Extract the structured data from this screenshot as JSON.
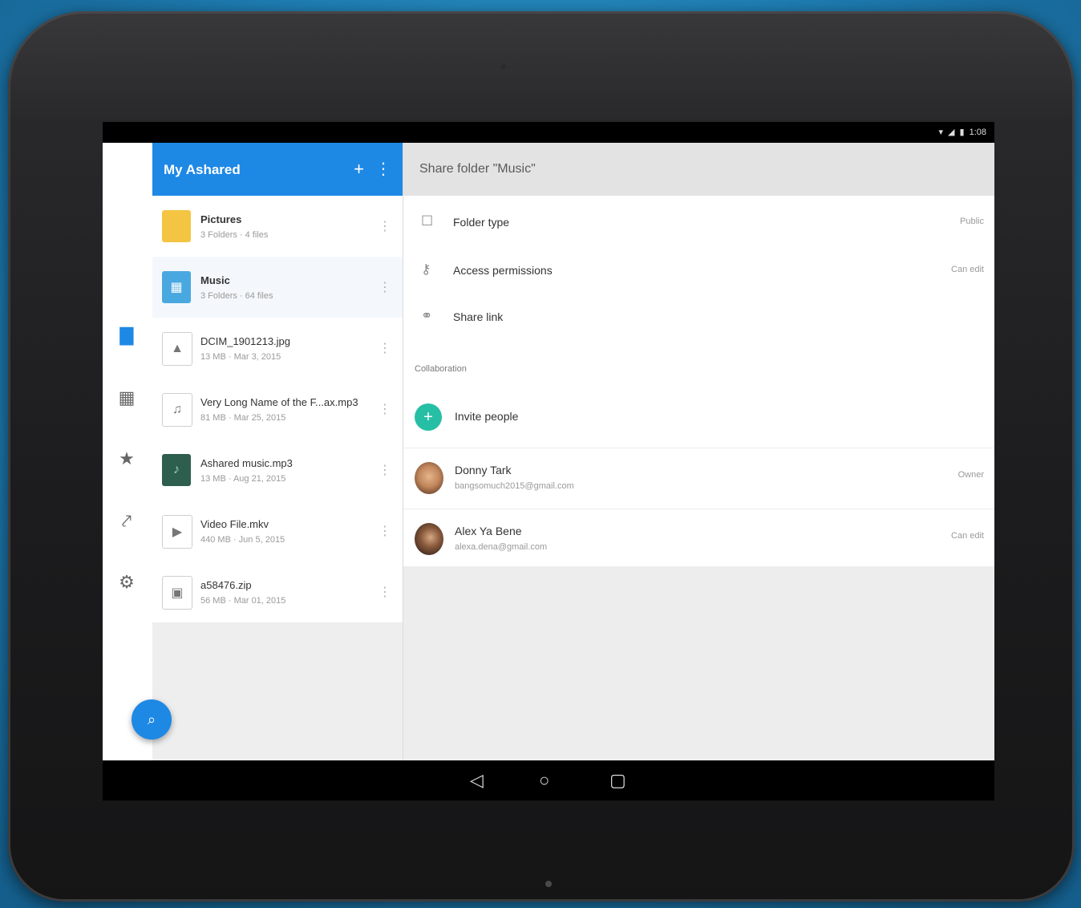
{
  "status_bar": {
    "icons": [
      "wifi-icon",
      "signal-icon",
      "battery-icon"
    ],
    "time": "1:08"
  },
  "rail": {
    "items": [
      {
        "icon": "folder-icon",
        "glyph": "▇",
        "active": true
      },
      {
        "icon": "shared-folder-icon",
        "glyph": "▦",
        "active": false
      },
      {
        "icon": "star-icon",
        "glyph": "★",
        "active": false
      },
      {
        "icon": "activity-icon",
        "glyph": "⤤",
        "active": false
      },
      {
        "icon": "settings-icon",
        "glyph": "⚙",
        "active": false
      }
    ],
    "fab_icon": "search-icon"
  },
  "list": {
    "title": "My Ashared",
    "add_icon": "plus-icon",
    "menu_icon": "more-vertical-icon",
    "files": [
      {
        "name": "Pictures",
        "meta": "3 Folders · 4 files",
        "icon": "folder-icon",
        "style": "folder-y",
        "bold": true,
        "selected": false,
        "glyph": ""
      },
      {
        "name": "Music",
        "meta": "3 Folders · 64 files",
        "icon": "shared-folder-icon",
        "style": "folder-b",
        "bold": true,
        "selected": true,
        "glyph": "▦"
      },
      {
        "name": "DCIM_1901213.jpg",
        "meta": "13 MB · Mar 3, 2015",
        "icon": "image-file-icon",
        "style": "doc",
        "bold": false,
        "selected": false,
        "glyph": "▲"
      },
      {
        "name": "Very Long Name of the F...ax.mp3",
        "meta": "81 MB · Mar 25, 2015",
        "icon": "audio-file-icon",
        "style": "doc",
        "bold": false,
        "selected": false,
        "glyph": "♫"
      },
      {
        "name": "Ashared music.mp3",
        "meta": "13 MB · Aug 21, 2015",
        "icon": "music-cover-icon",
        "style": "img",
        "bold": false,
        "selected": false,
        "glyph": "♪"
      },
      {
        "name": "Video File.mkv",
        "meta": "440 MB · Jun 5, 2015",
        "icon": "video-file-icon",
        "style": "doc",
        "bold": false,
        "selected": false,
        "glyph": "▶"
      },
      {
        "name": "a58476.zip",
        "meta": "56 MB · Mar 01, 2015",
        "icon": "archive-file-icon",
        "style": "doc",
        "bold": false,
        "selected": false,
        "glyph": "▣"
      }
    ]
  },
  "detail": {
    "title": "Share folder \"Music\"",
    "settings": [
      {
        "label": "Folder type",
        "value": "Public",
        "icon": "folder-outline-icon",
        "glyph": "☐"
      },
      {
        "label": "Access permissions",
        "value": "Can edit",
        "icon": "key-icon",
        "glyph": "⚷"
      },
      {
        "label": "Share link",
        "value": "",
        "icon": "link-icon",
        "glyph": "⚭"
      }
    ],
    "collab_header": "Collaboration",
    "invite_label": "Invite people",
    "people": [
      {
        "name": "Donny Tark",
        "email": "bangsomuch2015@gmail.com",
        "role": "Owner"
      },
      {
        "name": "Alex Ya Bene",
        "email": "alexa.dena@gmail.com",
        "role": "Can edit"
      }
    ]
  }
}
